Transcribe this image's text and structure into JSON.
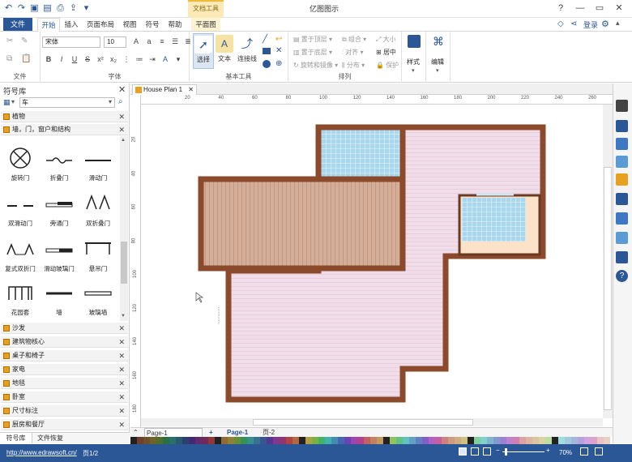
{
  "app": {
    "title": "亿图图示",
    "context_tab_group": "文档工具"
  },
  "quick_access": [
    "undo-icon",
    "redo-icon",
    "open-icon",
    "save-icon",
    "print-icon",
    "export-icon",
    "dropdown-icon"
  ],
  "window_controls": {
    "help": "?",
    "minimize": "—",
    "restore": "▭",
    "close": "✕"
  },
  "ribbon_tabs": [
    "开始",
    "插入",
    "页面布局",
    "视图",
    "符号",
    "帮助",
    "平面图"
  ],
  "active_tab": "开始",
  "file_tab": "文件",
  "top_right": {
    "login": "登录",
    "share_icon": "share-icon",
    "settings_icon": "gear-icon"
  },
  "font": {
    "name": "宋体",
    "size": "10"
  },
  "groups": {
    "file": "文件",
    "font": "字体",
    "basic_tools": "基本工具",
    "arrange": "排列",
    "style": "样式",
    "edit": "编辑"
  },
  "basic_tools_buttons": {
    "select": "选择",
    "text": "文本",
    "connector": "连接线"
  },
  "arrange_buttons": [
    "置于顶层",
    "置于底层",
    "旋转和镜像",
    "组合",
    "对齐",
    "分布",
    "大小",
    "居中",
    "保护"
  ],
  "library": {
    "title": "符号库",
    "search_value": "车",
    "categories_top": [
      "植物",
      "墙，门，窗户和结构"
    ],
    "shapes": [
      {
        "label": "旋转门"
      },
      {
        "label": "折叠门"
      },
      {
        "label": "滑动门"
      },
      {
        "label": "双滑动门"
      },
      {
        "label": "旁通门"
      },
      {
        "label": "双折叠门"
      },
      {
        "label": "复式双折门"
      },
      {
        "label": "滑动玻璃门"
      },
      {
        "label": "悬吊门"
      },
      {
        "label": "花园套"
      },
      {
        "label": "墙"
      },
      {
        "label": "玻璃墙"
      }
    ],
    "categories_bottom": [
      "沙发",
      "建筑物核心",
      "桌子和椅子",
      "家电",
      "地毯",
      "卧室",
      "尺寸标注",
      "厨房和餐厅"
    ],
    "bottom_tabs": [
      "符号库",
      "文件恢复"
    ]
  },
  "document_tab": "House Plan 1",
  "ruler_h": [
    "20",
    "40",
    "60",
    "80",
    "100",
    "120",
    "140",
    "160",
    "180",
    "200",
    "220",
    "240",
    "260",
    "280"
  ],
  "ruler_v": [
    "20",
    "40",
    "60",
    "80",
    "100",
    "120",
    "140",
    "160",
    "180"
  ],
  "pages": {
    "current": "Page-1",
    "tabs": [
      "Page-1",
      "页-2"
    ]
  },
  "status": {
    "url": "http://www.edrawsoft.cn/",
    "page": "页1/2",
    "zoom": "70%"
  },
  "colors": {
    "brand": "#2b5797",
    "wall": "#8b4a2b",
    "floor_pink": "#f1dde9",
    "wood": "#d4ae98",
    "tile": "#a9d8ee"
  }
}
